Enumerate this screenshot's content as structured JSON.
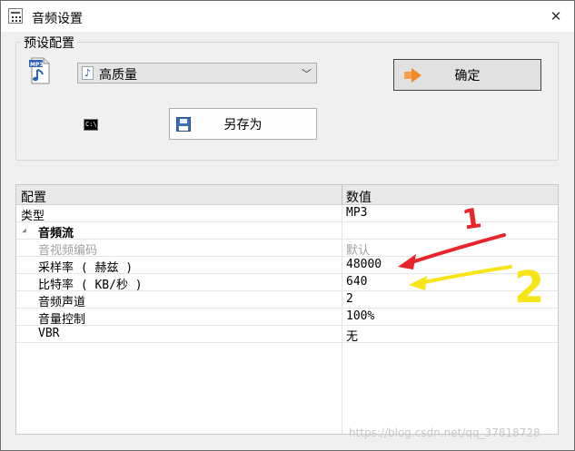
{
  "window": {
    "title": "音频设置",
    "close_glyph": "✕"
  },
  "preset": {
    "group_label": "预设配置",
    "selected": "高质量",
    "ok_label": "确定",
    "saveas_label": "另存为",
    "cmd_icon_text": "C:\\_"
  },
  "grid": {
    "headers": {
      "name": "配置",
      "value": "数值"
    },
    "rows": [
      {
        "name": "类型",
        "value": "MP3"
      },
      {
        "name": "音頻流",
        "value": ""
      },
      {
        "name": "音视频编码",
        "value": "默认"
      },
      {
        "name": "采样率 ( 赫兹 )",
        "value": "48000"
      },
      {
        "name": "比特率 ( KB/秒 )",
        "value": "640"
      },
      {
        "name": "音频声道",
        "value": "2"
      },
      {
        "name": "音量控制",
        "value": "100%"
      },
      {
        "name": "VBR",
        "value": "无"
      }
    ]
  },
  "annotations": {
    "mark1": "1",
    "mark2": "2",
    "mark1_color": "#e8262a",
    "mark2_color": "#f7e51a"
  },
  "watermark": "https://blog.csdn.net/qq_37818728"
}
